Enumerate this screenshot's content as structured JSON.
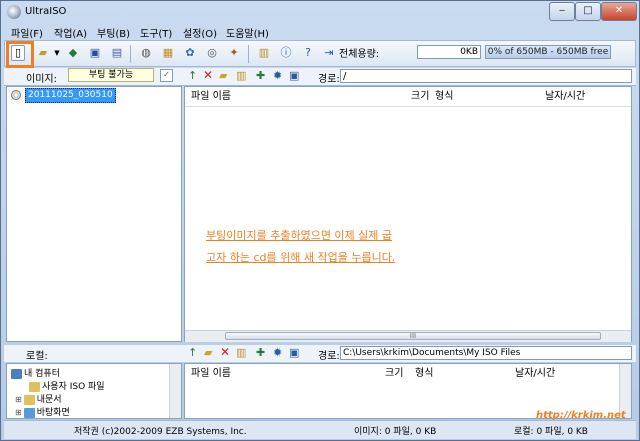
{
  "window": {
    "title": "UltraISO"
  },
  "menu": [
    "파일(F)",
    "작업(A)",
    "부팅(B)",
    "도구(T)",
    "설정(O)",
    "도움말(H)"
  ],
  "capacity": {
    "label": "전체용량:",
    "value": "0KB",
    "bar_text": "0% of 650MB - 650MB free",
    "percent": 0
  },
  "image_bar": {
    "label": "이미지:",
    "boot_value": "부팅 불가능",
    "path_label": "경로:",
    "path": "/"
  },
  "tree": {
    "root": "20111025_030510"
  },
  "file_list": {
    "columns": [
      "파일 이름",
      "크기",
      "형식",
      "날자/시간"
    ]
  },
  "annotation": {
    "line1": "부팅이미지를 추출하였으면 이제 실제 굽",
    "line2": "고자 하는 cd를 위해 새 작업을 누릅니다."
  },
  "scroll_thumb": "III",
  "local_bar": {
    "label": "로컬:",
    "path_label": "경로:",
    "path": "C:\\Users\\krkim\\Documents\\My ISO Files"
  },
  "local_tree": [
    "내 컴퓨터",
    "사용자 ISO 파일",
    "내문서",
    "바탕화면"
  ],
  "local_list": {
    "columns": [
      "파일 이름",
      "크기",
      "형식",
      "날자/시간"
    ]
  },
  "status": {
    "copyright": "저작권 (c)2002-2009 EZB Systems, Inc.",
    "image_info": "이미지: 0 파일, 0 KB",
    "local_info": "로컬: 0 파일, 0 KB"
  },
  "watermark": "http://krkim.net",
  "colors": {
    "accent": "#f07f22",
    "selection": "#3399ff"
  }
}
